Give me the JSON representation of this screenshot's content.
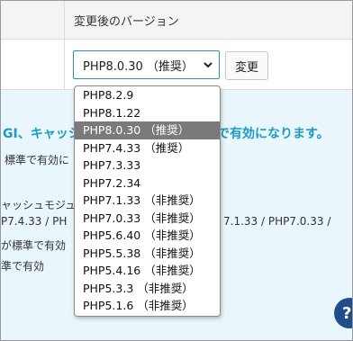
{
  "header": {
    "column_title": "変更後のバージョン"
  },
  "select": {
    "current_value": "PHP8.0.30 （推奨）"
  },
  "change_button": {
    "label": "変更"
  },
  "info": {
    "heading": "GI、キャッシ",
    "heading_end": "で有効になります。",
    "line1": "標準で有効に",
    "line2": "ャッシュモジュー",
    "line3a": "P7.4.33 / PH",
    "line3b": "7.1.33 / PHP7.0.33 /",
    "line4": "が標準で有効",
    "line5": "準で有効"
  },
  "help_button": {
    "label": "?"
  },
  "dropdown": {
    "options": [
      "PHP8.2.9",
      "PHP8.1.22",
      "PHP8.0.30 （推奨）",
      "PHP7.4.33 （推奨）",
      "PHP7.3.33",
      "PHP7.2.34",
      "PHP7.1.33 （非推奨）",
      "PHP7.0.33 （非推奨）",
      "PHP5.6.40 （非推奨）",
      "PHP5.5.38 （非推奨）",
      "PHP5.4.16 （非推奨）",
      "PHP5.3.3 （非推奨）",
      "PHP5.1.6 （非推奨）"
    ],
    "selected_index": 2
  },
  "colors": {
    "accent": "#2f8fb3",
    "info_bg": "#e9f6fb",
    "heading_blue": "#1d9bc4",
    "selected_bg": "#7a7a7a",
    "help_bg": "#1f4e8a"
  }
}
